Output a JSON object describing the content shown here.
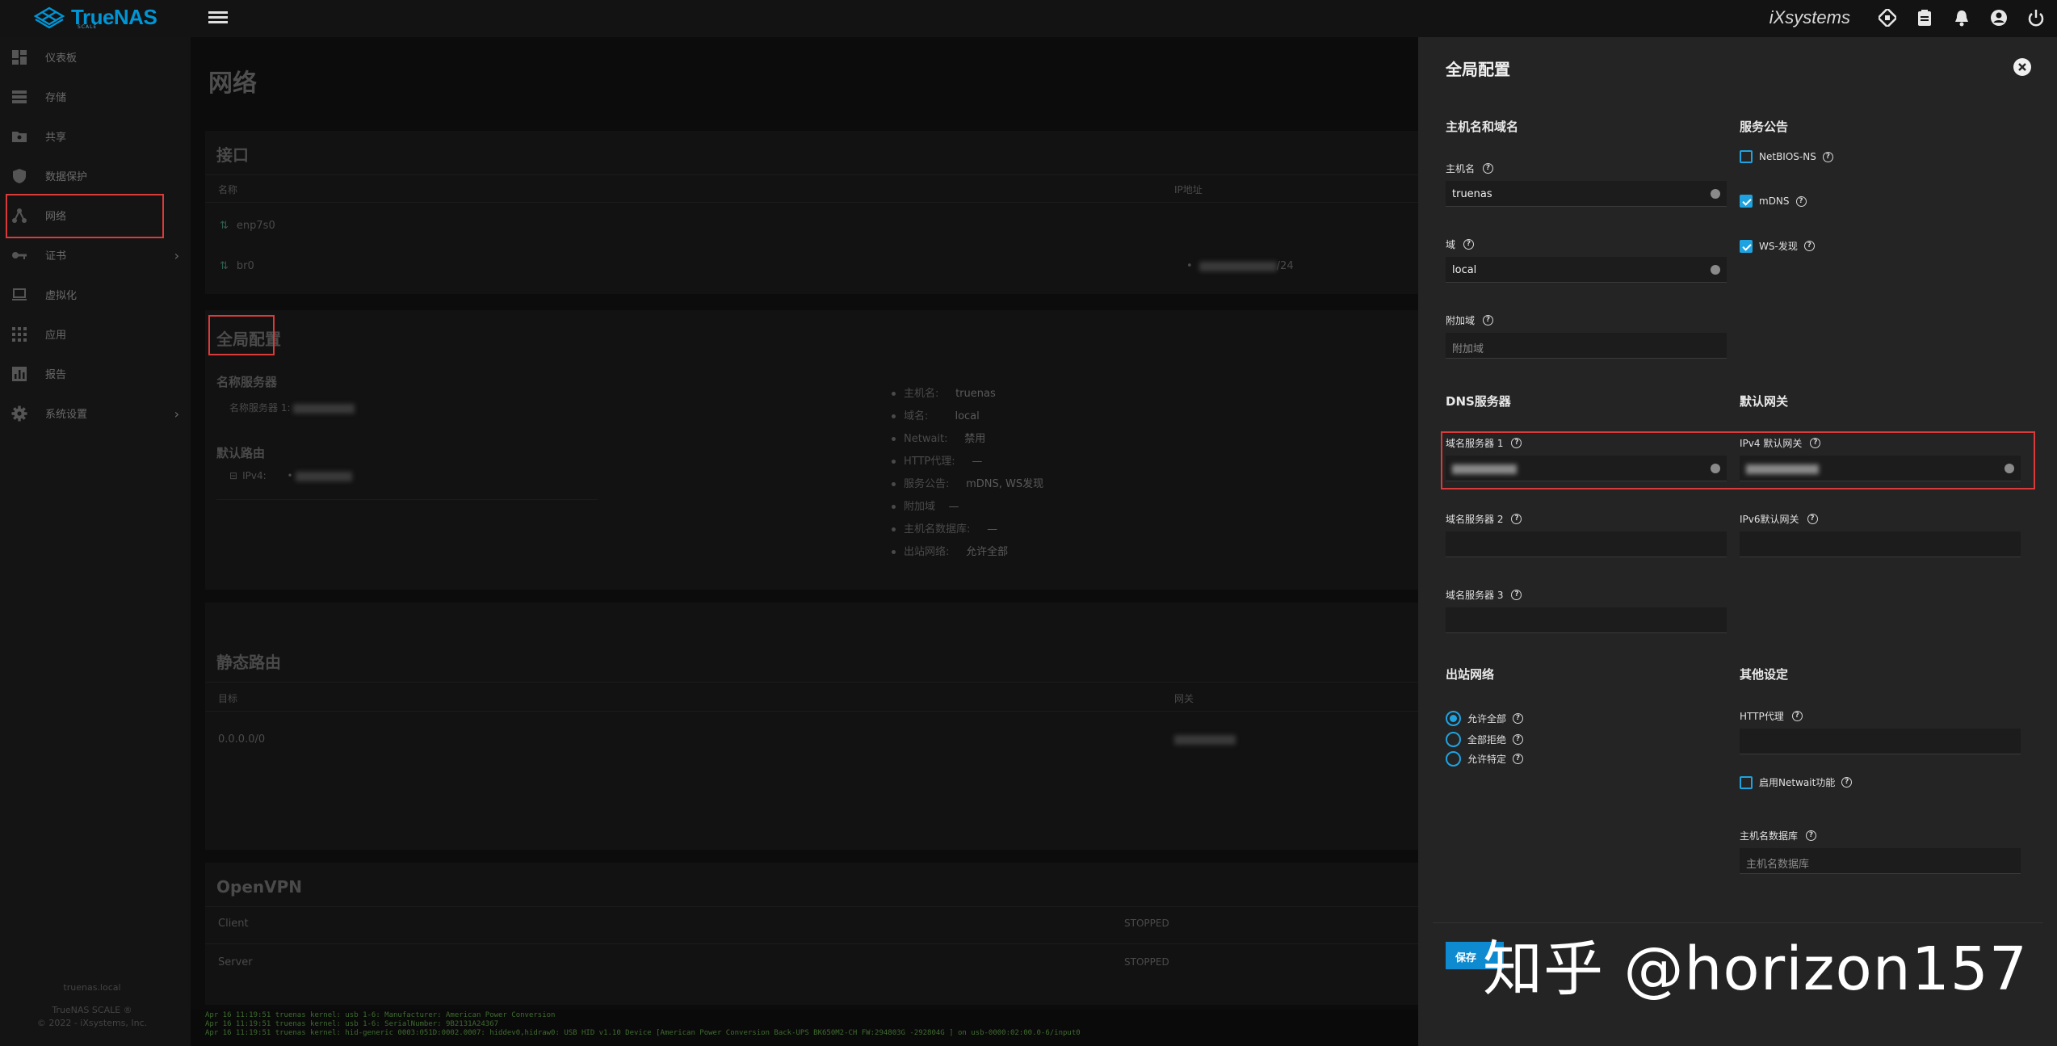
{
  "brand": {
    "name": "TrueNAS",
    "edition": "SCALE",
    "vendor": "iXsystems",
    "accent": "#0095d5"
  },
  "topbar": {
    "icons": [
      "truecommand-icon",
      "clipboard-icon",
      "bell-icon",
      "account-icon",
      "power-icon"
    ]
  },
  "sidebar": {
    "items": [
      {
        "label": "仪表板",
        "icon": "dashboard-icon"
      },
      {
        "label": "存储",
        "icon": "storage-icon"
      },
      {
        "label": "共享",
        "icon": "shares-icon"
      },
      {
        "label": "数据保护",
        "icon": "shield-icon"
      },
      {
        "label": "网络",
        "icon": "network-icon"
      },
      {
        "label": "证书",
        "icon": "key-icon"
      },
      {
        "label": "虚拟化",
        "icon": "laptop-icon"
      },
      {
        "label": "应用",
        "icon": "apps-icon"
      },
      {
        "label": "报告",
        "icon": "chart-icon"
      },
      {
        "label": "系统设置",
        "icon": "gear-icon"
      }
    ],
    "footer": {
      "hostname": "truenas.local",
      "product": "TrueNAS SCALE ®",
      "copyright": "© 2022 - iXsystems, Inc."
    }
  },
  "main": {
    "title": "网络",
    "interfaces": {
      "title": "接口",
      "col_name": "名称",
      "col_ip": "IP地址",
      "rows": [
        {
          "name": "enp7s0",
          "ip": ""
        },
        {
          "name": "br0",
          "ip": "/24"
        }
      ]
    },
    "global_config": {
      "title": "全局配置",
      "nameservers_title": "名称服务器",
      "nameserver1_label": "名称服务器 1:",
      "default_route_title": "默认路由",
      "ipv4_label": "IPv4:",
      "summary": [
        {
          "k": "主机名:",
          "v": "truenas"
        },
        {
          "k": "域名:",
          "v": "local"
        },
        {
          "k": "Netwait:",
          "v": "禁用"
        },
        {
          "k": "HTTP代理:",
          "v": "—"
        },
        {
          "k": "服务公告:",
          "v": "mDNS, WS发现"
        },
        {
          "k": "附加域",
          "v": "—"
        },
        {
          "k": "主机名数据库:",
          "v": "—"
        },
        {
          "k": "出站网络:",
          "v": "允许全部"
        }
      ]
    },
    "static_routes": {
      "title": "静态路由",
      "col_dest": "目标",
      "col_gateway": "网关",
      "rows": [
        {
          "dest": "0.0.0.0/0",
          "gateway": ""
        }
      ]
    },
    "openvpn": {
      "title": "OpenVPN",
      "rows": [
        {
          "name": "Client",
          "status": "STOPPED"
        },
        {
          "name": "Server",
          "status": "STOPPED"
        }
      ]
    }
  },
  "console": [
    "Apr 16 11:19:51 truenas kernel: usb 1-6: Manufacturer: American Power Conversion",
    "Apr 16 11:19:51 truenas kernel: usb 1-6: SerialNumber: 9B2131A24367",
    "Apr 16 11:19:51 truenas kernel: hid-generic 0003:051D:0002.0007: hiddev0,hidraw0: USB HID v1.10 Device [American Power Conversion Back-UPS BK650M2-CH FW:294803G -292804G ] on usb-0000:02:00.0-6/input0"
  ],
  "panel": {
    "title": "全局配置",
    "hostname_section": "主机名和域名",
    "hostname_label": "主机名",
    "hostname_value": "truenas",
    "domain_label": "域",
    "domain_value": "local",
    "additional_domains_label": "附加域",
    "additional_domains_placeholder": "附加域",
    "service_section": "服务公告",
    "netbios_label": "NetBIOS-NS",
    "netbios_checked": false,
    "mdns_label": "mDNS",
    "mdns_checked": true,
    "wsd_label": "WS-发现",
    "wsd_checked": true,
    "dns_section": "DNS服务器",
    "ns1_label": "域名服务器 1",
    "ns2_label": "域名服务器 2",
    "ns3_label": "域名服务器 3",
    "gateway_section": "默认网关",
    "ipv4_gw_label": "IPv4 默认网关",
    "ipv6_gw_label": "IPv6默认网关",
    "outbound_section": "出站网络",
    "outbound_options": [
      "允许全部",
      "全部拒绝",
      "允许特定"
    ],
    "outbound_selected": 0,
    "other_section": "其他设定",
    "http_proxy_label": "HTTP代理",
    "netwait_label": "启用Netwait功能",
    "netwait_checked": false,
    "hosts_label": "主机名数据库",
    "hosts_placeholder": "主机名数据库",
    "save_label": "保存"
  },
  "watermark": "知乎 @horizon157"
}
